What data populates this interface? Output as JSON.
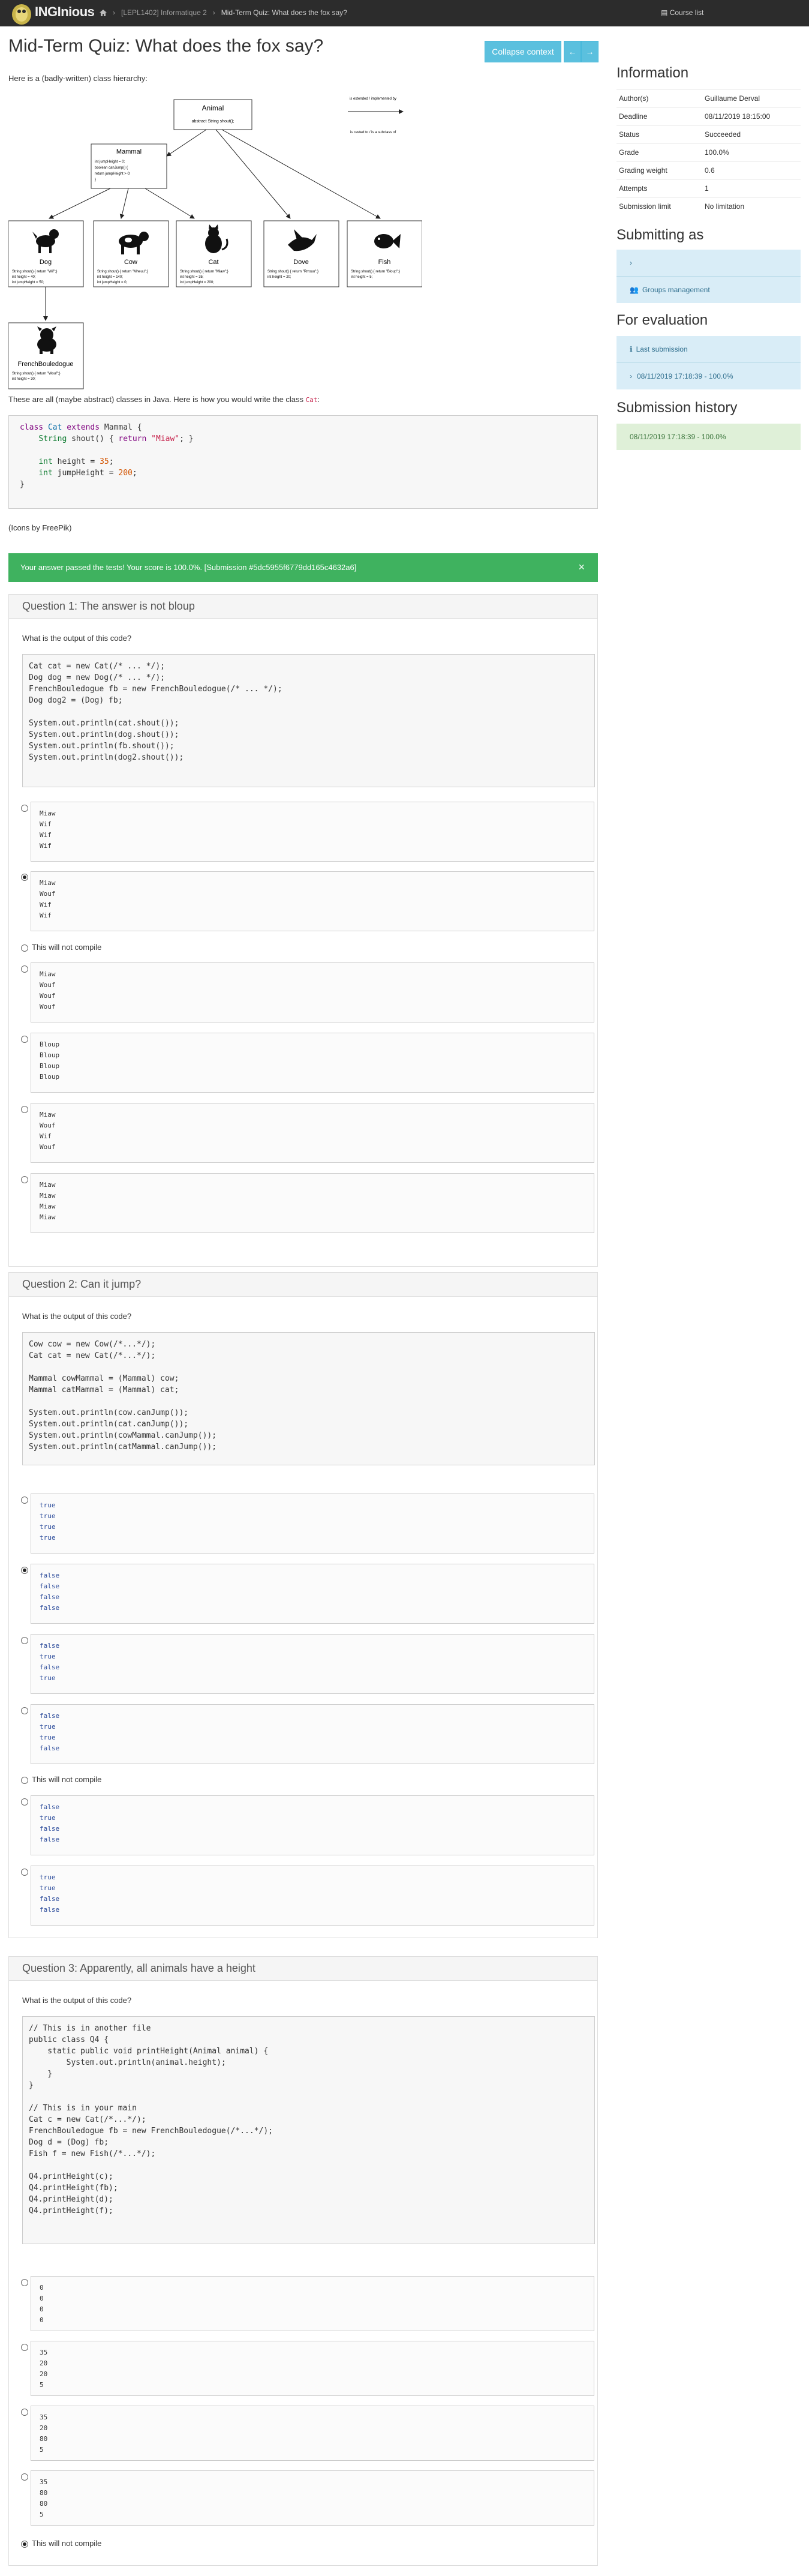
{
  "navbar": {
    "brand": "INGInious",
    "crumb_course": "[LEPL1402] Informatique 2",
    "crumb_task": "Mid-Term Quiz: What does the fox say?",
    "course_list": "Course list"
  },
  "page": {
    "title": "Mid-Term Quiz: What does the fox say?",
    "collapse_label": "Collapse context",
    "intro": "Here is a (badly-written) class hierarchy:",
    "caption_prefix": "These are all (maybe abstract) classes in Java. Here is how you would write the class ",
    "caption_class": "Cat",
    "caption_suffix": ":",
    "credit": "(Icons by FreePik)"
  },
  "diagram": {
    "animal_title": "Animal",
    "animal_body": "abstract String shout();",
    "legend_top": "is extended / implemented by",
    "legend_bottom": "is casted to / is a subclass of",
    "mammal_title": "Mammal",
    "mammal_l1": "int jumpHeight = 0;",
    "mammal_l2": "boolean canJump() {",
    "mammal_l3": "  return jumpHeight > 0;",
    "mammal_l4": "}",
    "dog_title": "Dog",
    "dog_l1": "String shout() { return \"Wif\";}",
    "dog_l2": "int height = 40;",
    "dog_l3": "int jumpHeight = 50;",
    "cow_title": "Cow",
    "cow_l1": "String shout() { return \"Mheuu\";}",
    "cow_l2": "int height = 140;",
    "cow_l3": "int jumpHeight = 0;",
    "cat_title": "Cat",
    "cat_l1": "String shout() { return \"Miaw\";}",
    "cat_l2": "int height = 35;",
    "cat_l3": "int jumpHeight = 200;",
    "dove_title": "Dove",
    "dove_l1": "String shout() { return \"Rrrouu\";}",
    "dove_l2": "int height = 20;",
    "fish_title": "Fish",
    "fish_l1": "String shout() { return \"Bloup\";}",
    "fish_l2": "int height = 5;",
    "fb_title": "FrenchBouledogue",
    "fb_l1": "String shout() { return \"Wouf\";}",
    "fb_l2": "int height = 30;"
  },
  "cat_code": {
    "l1_kw": "class",
    "l1_name": "Cat",
    "l1_kw2": "extends",
    "l1_parent": "Mammal {",
    "l2_type": "String",
    "l2_rest": " shout() { ",
    "l2_ret": "return",
    "l2_str": "\"Miaw\"",
    "l2_end": "; }",
    "l3_type": "int",
    "l3_rest": " height = ",
    "l3_num": "35",
    "l3_end": ";",
    "l4_type": "int",
    "l4_rest": " jumpHeight = ",
    "l4_num": "200",
    "l4_end": ";",
    "l5": "}"
  },
  "alert": {
    "text": "Your answer passed the tests! Your score is 100.0%. [Submission #5dc5955f6779dd165c4632a6]",
    "close": "×"
  },
  "q1": {
    "title": "Question 1: The answer is not bloup",
    "label": "What is the output of this code?",
    "code": "Cat cat = new Cat(/* ... */);\nDog dog = new Dog(/* ... */);\nFrenchBouledogue fb = new FrenchBouledogue(/* ... */);\nDog dog2 = (Dog) fb;\n\nSystem.out.println(cat.shout());\nSystem.out.println(dog.shout());\nSystem.out.println(fb.shout());\nSystem.out.println(dog2.shout());",
    "options": [
      "Miaw\nWif\nWif\nWif",
      "Miaw\nWouf\nWif\nWif",
      "This will not compile",
      "Miaw\nWouf\nWouf\nWouf",
      "Bloup\nBloup\nBloup\nBloup",
      "Miaw\nWouf\nWif\nWouf",
      "Miaw\nMiaw\nMiaw\nMiaw"
    ]
  },
  "q2": {
    "title": "Question 2: Can it jump?",
    "label": "What is the output of this code?",
    "code": "Cow cow = new Cow(/*...*/);\nCat cat = new Cat(/*...*/);\n\nMammal cowMammal = (Mammal) cow;\nMammal catMammal = (Mammal) cat;\n\nSystem.out.println(cow.canJump());\nSystem.out.println(cat.canJump());\nSystem.out.println(cowMammal.canJump());\nSystem.out.println(catMammal.canJump());",
    "options": [
      "true\ntrue\ntrue\ntrue",
      "false\nfalse\nfalse\nfalse",
      "false\ntrue\nfalse\ntrue",
      "false\ntrue\ntrue\nfalse",
      "This will not compile",
      "false\ntrue\nfalse\nfalse",
      "true\ntrue\nfalse\nfalse"
    ]
  },
  "q3": {
    "title": "Question 3: Apparently, all animals have a height",
    "label": "What is the output of this code?",
    "code": "// This is in another file\npublic class Q4 {\n    static public void printHeight(Animal animal) {\n        System.out.println(animal.height);\n    }\n}\n\n// This is in your main\nCat c = new Cat(/*...*/);\nFrenchBouledogue fb = new FrenchBouledogue(/*...*/);\nDog d = (Dog) fb;\nFish f = new Fish(/*...*/);\n\nQ4.printHeight(c);\nQ4.printHeight(fb);\nQ4.printHeight(d);\nQ4.printHeight(f);",
    "options": [
      "0\n0\n0\n0",
      "35\n20\n20\n5",
      "35\n20\n80\n5",
      "35\n80\n80\n5",
      "This will not compile"
    ]
  },
  "sidebar": {
    "info_title": "Information",
    "info_rows": [
      [
        "Author(s)",
        "Guillaume Derval"
      ],
      [
        "Deadline",
        "08/11/2019 18:15:00"
      ],
      [
        "Status",
        "Succeeded"
      ],
      [
        "Grade",
        "100.0%"
      ],
      [
        "Grading weight",
        "0.6"
      ],
      [
        "Attempts",
        "1"
      ],
      [
        "Submission limit",
        "No limitation"
      ]
    ],
    "submitting_title": "Submitting as",
    "groups_label": "Groups management",
    "eval_title": "For evaluation",
    "last_submission": "Last submission",
    "eval_entry": "08/11/2019 17:18:39 - 100.0%",
    "history_title": "Submission history",
    "history_entry": "08/11/2019 17:18:39 - 100.0%"
  }
}
